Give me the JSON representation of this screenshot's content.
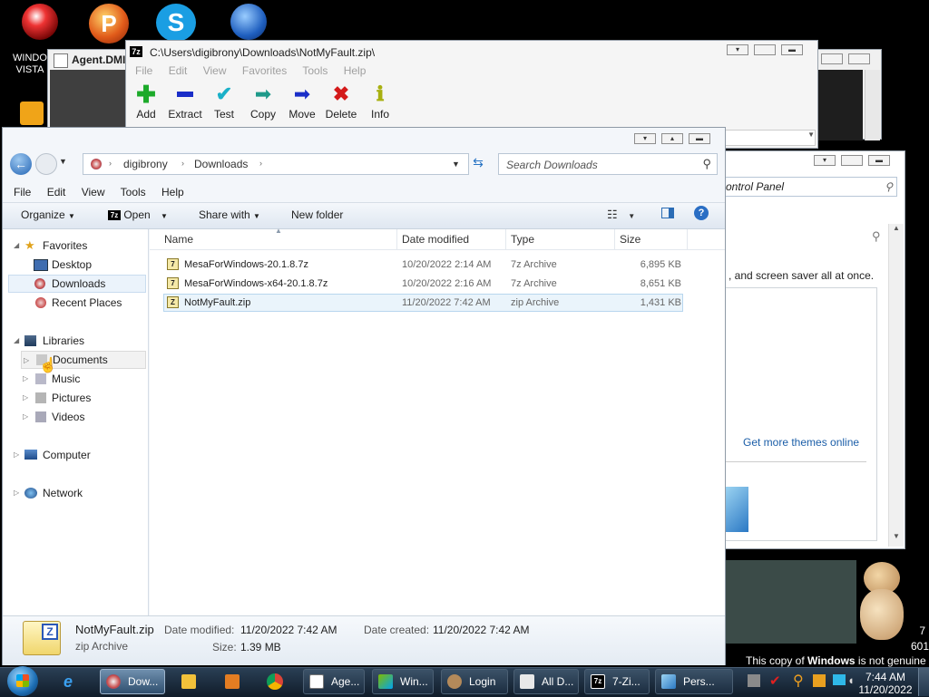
{
  "desktop": {
    "icon1_label": "WINDO",
    "icon1_label2": "VISTA",
    "watermark": "This copy of Windows is not genuine",
    "watermark_a": "This copy of ",
    "watermark_b": "Windows",
    "watermark_c": " is not genuine",
    "build_a": "7",
    "build_b": "601"
  },
  "agent_window": {
    "title": "Agent.DMI"
  },
  "zip_window": {
    "title": "C:\\Users\\digibrony\\Downloads\\NotMyFault.zip\\",
    "menu": [
      "File",
      "Edit",
      "View",
      "Favorites",
      "Tools",
      "Help"
    ],
    "toolbar": [
      "Add",
      "Extract",
      "Test",
      "Copy",
      "Move",
      "Delete",
      "Info"
    ]
  },
  "cp_window": {
    "search_text": "ontrol Panel",
    "text1": ", and screen saver all at once.",
    "link": "Get more themes online"
  },
  "explorer": {
    "breadcrumb": [
      "digibrony",
      "Downloads"
    ],
    "search_placeholder": "Search Downloads",
    "menu": [
      "File",
      "Edit",
      "View",
      "Tools",
      "Help"
    ],
    "commands": {
      "organize": "Organize",
      "open": "Open",
      "share": "Share with",
      "new_folder": "New folder"
    },
    "nav": {
      "favorites": "Favorites",
      "desktop": "Desktop",
      "downloads": "Downloads",
      "recent": "Recent Places",
      "libraries": "Libraries",
      "documents": "Documents",
      "music": "Music",
      "pictures": "Pictures",
      "videos": "Videos",
      "computer": "Computer",
      "network": "Network"
    },
    "columns": {
      "name": "Name",
      "date": "Date modified",
      "type": "Type",
      "size": "Size"
    },
    "files": [
      {
        "name": "MesaForWindows-20.1.8.7z",
        "date": "10/20/2022 2:14 AM",
        "type": "7z Archive",
        "size": "6,895 KB"
      },
      {
        "name": "MesaForWindows-x64-20.1.8.7z",
        "date": "10/20/2022 2:16 AM",
        "type": "7z Archive",
        "size": "8,651 KB"
      },
      {
        "name": "NotMyFault.zip",
        "date": "11/20/2022 7:42 AM",
        "type": "zip Archive",
        "size": "1,431 KB"
      }
    ],
    "details": {
      "name": "NotMyFault.zip",
      "kind": "zip Archive",
      "modified_label": "Date modified:",
      "modified": "11/20/2022 7:42 AM",
      "created_label": "Date created:",
      "created": "11/20/2022 7:42 AM",
      "size_label": "Size:",
      "size": "1.39 MB"
    }
  },
  "taskbar": {
    "buttons": [
      "Dow...",
      "Age...",
      "Win...",
      "Login",
      "All D...",
      "7-Zi...",
      "Pers..."
    ],
    "time": "7:44 AM",
    "date": "11/20/2022"
  },
  "colors": {
    "accent": "#3a78c3",
    "taskbar": "#1a2a3b",
    "link": "#1b5ea8"
  }
}
